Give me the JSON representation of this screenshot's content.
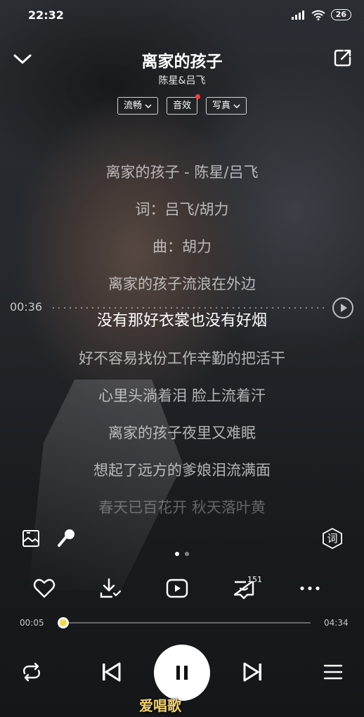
{
  "status_bar": {
    "time": "22:32",
    "battery": "26"
  },
  "header": {
    "title": "离家的孩子",
    "artist": "陈星&吕飞",
    "chips": [
      {
        "label": "流畅",
        "has_dropdown": true
      },
      {
        "label": "音效",
        "has_badge": true
      },
      {
        "label": "写真",
        "has_dropdown": true
      }
    ]
  },
  "lyrics": [
    "离家的孩子 - 陈星/吕飞",
    "词：吕飞/胡力",
    "曲：胡力",
    "离家的孩子流浪在外边",
    "没有那好衣裳也没有好烟",
    "好不容易找份工作辛勤的把活干",
    "心里头淌着泪 脸上流着汗",
    "离家的孩子夜里又难眠",
    "想起了远方的爹娘泪流满面",
    "春天已百花开 秋天落叶黄"
  ],
  "seek_marker": {
    "time": "00:36"
  },
  "tools": {
    "lyric_badge": "词"
  },
  "actions": {
    "comment_count": "151"
  },
  "progress": {
    "current": "00:05",
    "total": "04:34",
    "fraction": 0.018
  },
  "watermark": "爱唱歌",
  "colors": {
    "accent_thumb": "#f0d94a",
    "badge_red": "#ff3b3b",
    "watermark": "#f3d36a"
  }
}
